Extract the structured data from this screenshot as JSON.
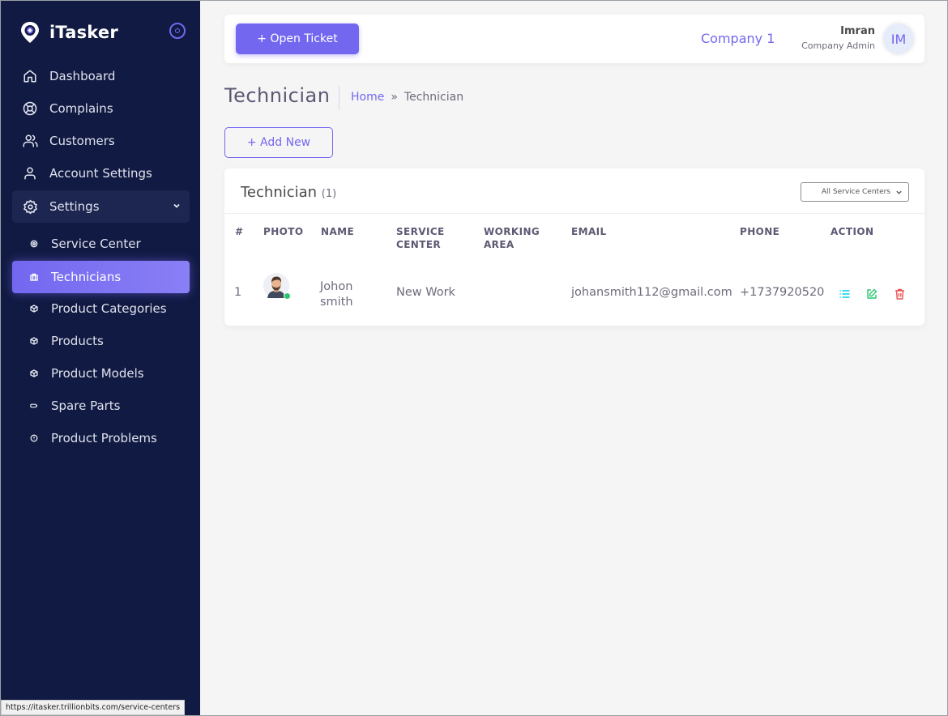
{
  "brand": {
    "name": "iTasker"
  },
  "sidebar": {
    "nav": [
      {
        "label": "Dashboard",
        "icon": "home-icon"
      },
      {
        "label": "Complains",
        "icon": "life-buoy-icon"
      },
      {
        "label": "Customers",
        "icon": "users-icon"
      },
      {
        "label": "Account Settings",
        "icon": "user-icon"
      },
      {
        "label": "Settings",
        "icon": "gear-icon"
      }
    ],
    "settings_sub": [
      {
        "label": "Service Center",
        "icon": "circle-icon",
        "active": false
      },
      {
        "label": "Technicians",
        "icon": "briefcase-icon",
        "active": true
      },
      {
        "label": "Product Categories",
        "icon": "box-icon",
        "active": false
      },
      {
        "label": "Products",
        "icon": "box-icon",
        "active": false
      },
      {
        "label": "Product Models",
        "icon": "box-icon",
        "active": false
      },
      {
        "label": "Spare Parts",
        "icon": "battery-icon",
        "active": false
      },
      {
        "label": "Product Problems",
        "icon": "alert-circle-icon",
        "active": false
      }
    ]
  },
  "status_url": "https://itasker.trillionbits.com/service-centers",
  "topbar": {
    "open_ticket_label": "+ Open Ticket",
    "company": "Company 1",
    "user_name": "Imran",
    "user_role": "Company Admin",
    "avatar_initials": "IM"
  },
  "page": {
    "title": "Technician",
    "breadcrumb_home": "Home",
    "breadcrumb_sep": "»",
    "breadcrumb_current": "Technician",
    "add_new_label": "+ Add New"
  },
  "card": {
    "title": "Technician",
    "count": "(1)",
    "service_center_filter": "All Service Centers"
  },
  "table": {
    "headers": {
      "num": "#",
      "photo": "PHOTO",
      "name": "NAME",
      "service_center_1": "SERVICE",
      "service_center_2": "CENTER",
      "working_area_1": "WORKING",
      "working_area_2": "AREA",
      "email": "EMAIL",
      "phone": "PHONE",
      "action": "ACTION"
    },
    "rows": [
      {
        "num": "1",
        "name_1": "Johon",
        "name_2": "smith",
        "service_center": "New Work",
        "working_area": "",
        "email": "johansmith112@gmail.com",
        "phone": "+1737920520"
      }
    ]
  },
  "colors": {
    "sidebar_bg": "#111a42",
    "accent": "#7367f0",
    "action_view": "#00cfe8",
    "action_edit": "#28c76f",
    "action_delete": "#ea5455"
  }
}
